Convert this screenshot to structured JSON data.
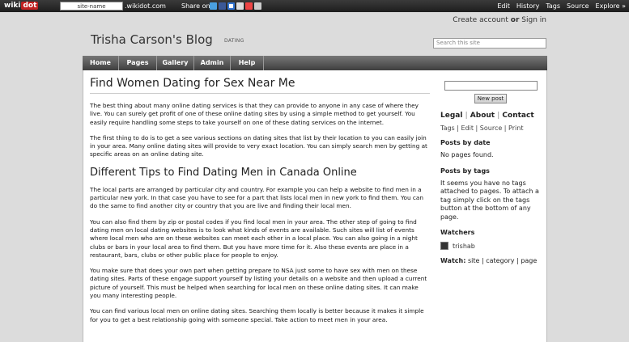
{
  "topbar": {
    "logo_text": "wiki",
    "logo_dot": "dot",
    "site_input": "site-name",
    "domain": ".wikidot.com",
    "share_label": "Share on",
    "menu": [
      "Edit",
      "History",
      "Tags",
      "Source",
      "Explore »"
    ]
  },
  "header": {
    "account_create": "Create account",
    "account_or": "or",
    "account_signin": "Sign in",
    "site_title": "Trisha Carson's Blog",
    "site_subtitle": "DATING",
    "search_placeholder": "Search this site"
  },
  "nav": [
    "Home",
    "Pages",
    "Gallery",
    "Admin",
    "Help"
  ],
  "main": {
    "title": "Find Women Dating for Sex Near Me",
    "p1": "The best thing about many online dating services is that they can provide to anyone in any case of where they live. You can surely get profit of one of these online dating sites by using a simple method to get yourself. You easily require handling some steps to take yourself on one of these dating services on the internet.",
    "p2": "The first thing to do is to get a see various sections on dating sites that list by their location to you can easily join in your area. Many online dating sites will provide to very exact location. You can simply search men by getting at specific areas on an online dating site.",
    "h2": "Different Tips to Find Dating Men in Canada Online",
    "p3": "The local parts are arranged by particular city and country. For example you can help a website to find men in a particular new york. In that case you have to see for a part that lists local men in new york to find them. You can do the same to find another city or country that you are live and finding their local men.",
    "p4": "You can also find them by zip or postal codes if you find local men in your area. The other step of going to find dating men on local dating websites is to look what kinds of events are available. Such sites will list of events where local men who are on these websites can meet each other in a local place. You can also going in a night clubs or bars in your local area to find them. But you have more time for it. Also these events are place in a restaurant, bars, clubs or other public place for people to enjoy.",
    "p5": "You make sure that does your own part when getting prepare to NSA just some to have sex with men on these dating sites. Parts of these engage support yourself by listing your details on a website and then upload a current picture of yourself. This must be helped when searching for local men on these online dating sites. It can make you many interesting people.",
    "p6": "You can find various local men on online dating sites. Searching them locally is better because it makes it simple for you to get a best relationship going with someone special. Take action to meet men in your area."
  },
  "side": {
    "new_post": "New post",
    "links": [
      "Legal",
      "About",
      "Contact"
    ],
    "sub": [
      "Tags",
      "Edit",
      "Source",
      "Print"
    ],
    "posts_by_date": "Posts by date",
    "no_pages": "No pages found.",
    "posts_by_tags": "Posts by tags",
    "tags_text": "It seems you have no tags attached to pages. To attach a tag simply click on the tags button at the bottom of any page.",
    "watchers": "Watchers",
    "watcher_name": "trishab",
    "watch_label": "Watch:",
    "watch_items": [
      "site",
      "category",
      "page"
    ]
  },
  "colors": {
    "topbar": "#2a2a2a",
    "nav": "#555555",
    "background": "#dcdcdc"
  }
}
